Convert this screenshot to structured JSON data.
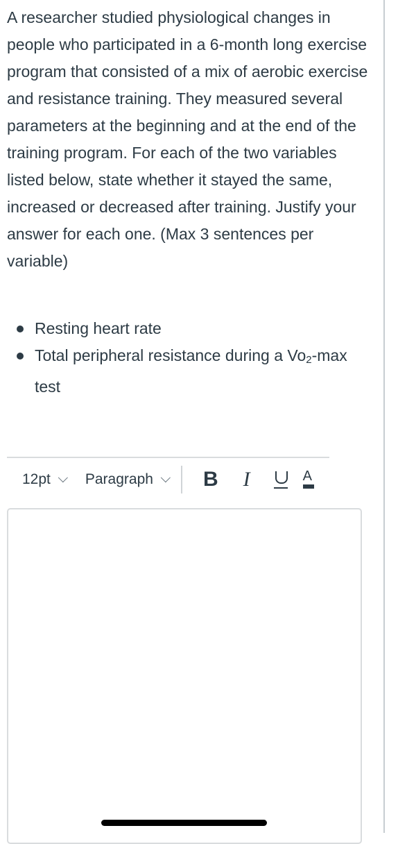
{
  "question": {
    "paragraph": "A researcher studied physiological changes in people who participated in a 6-month long exercise program that consisted of a mix of aerobic exercise and resistance training. They measured several parameters at the beginning and at the end of the training program. For each of the two variables listed below, state whether it stayed the same, increased or decreased after training. Justify your answer for each one. (Max 3 sentences per variable)",
    "bullets": [
      {
        "text": "Resting heart rate"
      },
      {
        "text_before": "Total peripheral resistance during a Vo",
        "subscript": "2",
        "text_after": "-max test"
      }
    ]
  },
  "toolbar": {
    "font_size": "12pt",
    "block_format": "Paragraph",
    "bold_label": "B",
    "italic_label": "I",
    "underline_icon": "underline-icon",
    "text_color_label": "A",
    "text_color_icon": "text-color-icon"
  },
  "editor": {
    "content": ""
  }
}
